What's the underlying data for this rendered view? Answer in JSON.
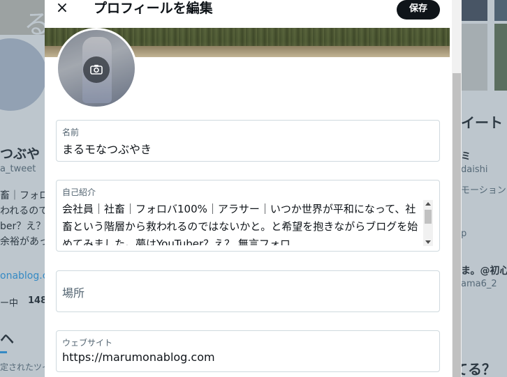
{
  "modal": {
    "title": "プロフィールを編集",
    "close_label": "×",
    "save_label": "保存"
  },
  "fields": {
    "name": {
      "label": "名前",
      "value": "まるモなつぶやき"
    },
    "bio": {
      "label": "自己紹介",
      "value": "会社員｜社畜｜フォロバ100%｜アラサー｜いつか世界が平和になって、社畜という階層から救われるのではないかと。と希望を抱きながらブログを始めてみました。夢はYouTuber？え？ 無言フォロ"
    },
    "location": {
      "placeholder": "場所"
    },
    "website": {
      "label": "ウェブサイト",
      "value": "https://marumonablog.com"
    }
  },
  "background": {
    "left": {
      "logo_char": "る",
      "name": "つぶや",
      "handle": "a_tweet",
      "bio_line1": "畜｜フォロ",
      "bio_line2": "われるので",
      "bio_line3": "ber？え？",
      "bio_line4": "余裕があっ",
      "link": "onablog.co",
      "following_label": "ー中",
      "followers_count": "148",
      "tab_char": "ヘ",
      "pinned_label": "定されたツイ"
    },
    "right": {
      "heading": "イート",
      "item1_name": "ミ",
      "item1_handle": "daishi",
      "item1_text": "モーション",
      "item2_text": "p",
      "item3_name": "ま。@初心",
      "item3_handle": "ama6_2",
      "bottom_text": "てる？"
    }
  },
  "icons": {
    "close": "close-icon",
    "camera": "camera-add-icon"
  },
  "colors": {
    "save_button_bg": "#0f1419",
    "label": "#536471",
    "border": "#cfd9de",
    "link": "#1d9bf0"
  }
}
